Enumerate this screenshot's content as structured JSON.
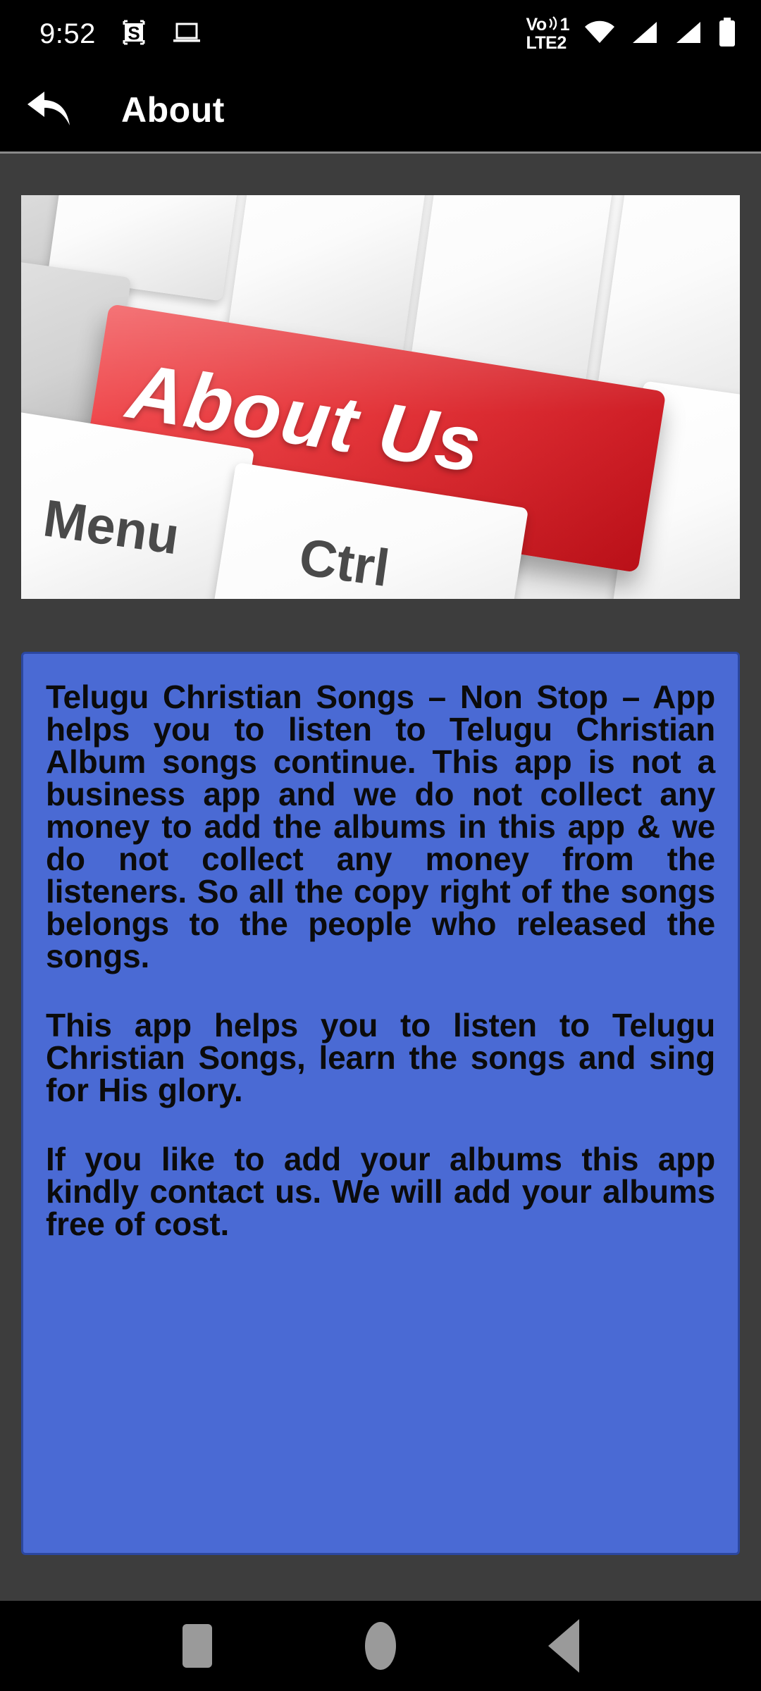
{
  "status_bar": {
    "clock": "9:52",
    "left_icons": [
      {
        "name": "screenshot-app-icon",
        "glyph": "S"
      },
      {
        "name": "cast-laptop-icon",
        "glyph": "laptop"
      }
    ],
    "volte": {
      "line1": "Vo",
      "sim1": "1",
      "line2": "LTE",
      "sim2": "2"
    },
    "right_icons": [
      {
        "name": "volte-icon"
      },
      {
        "name": "wifi-icon"
      },
      {
        "name": "signal-sim1-icon"
      },
      {
        "name": "signal-sim2-icon"
      },
      {
        "name": "battery-icon"
      }
    ]
  },
  "app_bar": {
    "back_label": "back-arrow",
    "title": "About"
  },
  "hero_image": {
    "alt": "About Us red keyboard key",
    "red_key_label": "About Us",
    "keys": [
      {
        "label": "#",
        "name": "hash-key"
      },
      {
        "label": "Menu",
        "name": "menu-key"
      },
      {
        "label": "Ctrl",
        "name": "ctrl-key"
      }
    ]
  },
  "about": {
    "paragraphs": [
      "Telugu Christian Songs – Non Stop – App helps you to listen to Telugu Christian Album songs continue.  This app is not a business app and we do not collect any money to add the albums in this app & we do not collect any money from the listeners.  So all the copy right of the songs belongs to the people who released the songs.",
      "This app helps you to listen to Telugu Christian Songs, learn the songs and sing for His glory.",
      "If you like to add your albums this app kindly contact us.  We will add your albums free of cost."
    ]
  },
  "nav_bar": {
    "buttons": [
      {
        "name": "nav-recents-button",
        "label": "recents"
      },
      {
        "name": "nav-home-button",
        "label": "home"
      },
      {
        "name": "nav-back-button",
        "label": "back"
      }
    ]
  },
  "colors": {
    "app_bar_background": "#000000",
    "page_background": "#3d3d3d",
    "about_card_background": "#4a6ad4",
    "about_card_border": "#2b47a0",
    "about_text": "#0b0b0b",
    "accent_red_key": "#e22c31",
    "nav_icon": "#9a9a9a"
  }
}
